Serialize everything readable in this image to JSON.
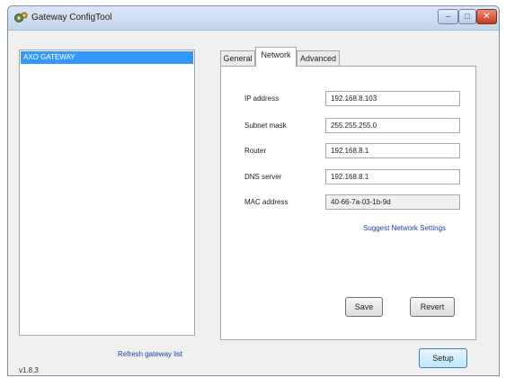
{
  "window": {
    "title": "Gateway ConfigTool"
  },
  "gateways": {
    "items": [
      {
        "label": "AXO GATEWAY",
        "selected": true
      }
    ],
    "refresh_label": "Refresh gateway list"
  },
  "version": "v1.8.3",
  "tabs": [
    {
      "label": "General",
      "active": false
    },
    {
      "label": "Network",
      "active": true
    },
    {
      "label": "Advanced",
      "active": false
    }
  ],
  "network": {
    "fields": [
      {
        "label": "IP address",
        "value": "192.168.8.103",
        "readonly": false
      },
      {
        "label": "Subnet mask",
        "value": "255.255.255.0",
        "readonly": false
      },
      {
        "label": "Router",
        "value": "192.168.8.1",
        "readonly": false
      },
      {
        "label": "DNS server",
        "value": "192.168.8.1",
        "readonly": false
      },
      {
        "label": "MAC address",
        "value": "40-66-7a-03-1b-9d",
        "readonly": true
      }
    ],
    "suggest_label": "Suggest Network Settings",
    "save_label": "Save",
    "revert_label": "Revert"
  },
  "setup_label": "Setup",
  "icons": {
    "app": "gear-icon",
    "minimize": "minimize-icon",
    "maximize": "maximize-icon",
    "close": "close-icon"
  },
  "colors": {
    "selection": "#3399ff",
    "link": "#1a3f9c",
    "close_button": "#c23b22"
  }
}
